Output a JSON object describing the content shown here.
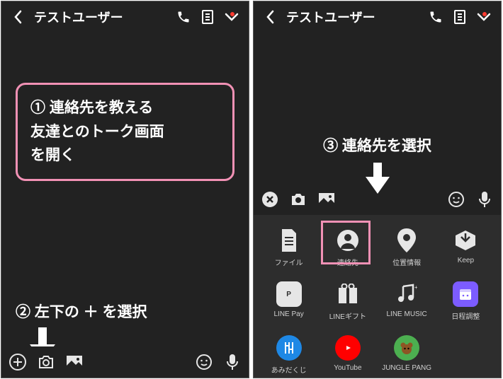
{
  "header": {
    "title": "テストユーザー"
  },
  "callouts": {
    "step1": "① 連絡先を教える\n     友達とのトーク画面\n     を開く",
    "step2": "② 左下の ＋ を選択",
    "step3": "③ 連絡先を選択"
  },
  "share_items": {
    "r1": [
      {
        "label": "ファイル",
        "name": "file"
      },
      {
        "label": "連絡先",
        "name": "contact"
      },
      {
        "label": "位置情報",
        "name": "location"
      },
      {
        "label": "Keep",
        "name": "keep"
      }
    ],
    "r2": [
      {
        "label": "LINE Pay",
        "name": "linepay"
      },
      {
        "label": "LINEギフト",
        "name": "linegift"
      },
      {
        "label": "LINE MUSIC",
        "name": "linemusic"
      },
      {
        "label": "日程調整",
        "name": "schedule"
      }
    ],
    "r3": [
      {
        "label": "あみだくじ",
        "name": "amida"
      },
      {
        "label": "YouTube",
        "name": "youtube"
      },
      {
        "label": "JUNGLE PANG",
        "name": "junglepang"
      }
    ]
  },
  "icons": {
    "back": "chevron-left",
    "call": "phone",
    "list": "list",
    "menu": "chevron-down",
    "plus": "plus",
    "camera": "camera",
    "gallery": "image",
    "smile": "smile",
    "mic": "mic",
    "close": "close"
  }
}
